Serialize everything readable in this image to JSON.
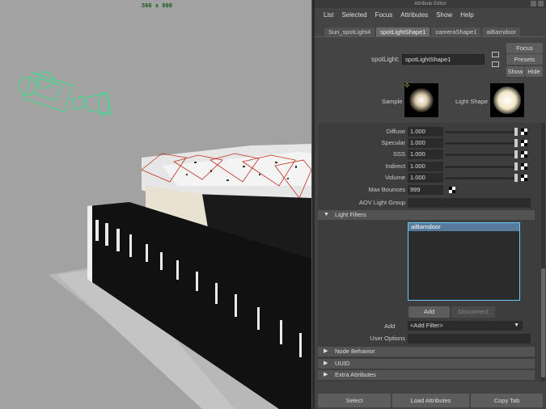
{
  "viewport": {
    "resolution_label": "566 x 800"
  },
  "editor": {
    "window_title": "Attribute Editor",
    "menu": [
      "List",
      "Selected",
      "Focus",
      "Attributes",
      "Show",
      "Help"
    ],
    "tabs": [
      "Sun_spotLight4",
      "spotLightShape1",
      "cameraShape1",
      "aiBarndoor"
    ],
    "node_label": "spotLight:",
    "node_value": "spotLightShape1",
    "buttons": {
      "focus": "Focus",
      "presets": "Presets",
      "show": "Show",
      "hide": "Hide"
    },
    "sample_label": "Sample",
    "light_shape_label": "Light Shape",
    "attributes": [
      {
        "label": "Diffuse",
        "value": "1.000"
      },
      {
        "label": "Specular",
        "value": "1.000"
      },
      {
        "label": "SSS",
        "value": "1.000"
      },
      {
        "label": "Indirect",
        "value": "1.000"
      },
      {
        "label": "Volume",
        "value": "1.000"
      }
    ],
    "max_bounces": {
      "label": "Max Bounces",
      "value": "999"
    },
    "aov_group_label": "AOV Light Group",
    "light_filters": {
      "header": "Light Filters",
      "items": [
        "aiBarndoor"
      ],
      "add_button": "Add",
      "disconnect_button": "Disconnect",
      "add_label": "Add",
      "add_filter_value": "<Add Filter>",
      "user_options_label": "User Options"
    },
    "sections": [
      "Node Behavior",
      "UUID",
      "Extra Attributes"
    ],
    "bottom_buttons": [
      "Select",
      "Load Attributes",
      "Copy Tab"
    ]
  },
  "colors": {
    "accent_selection": "#587a9a",
    "viewport_bg": "#a2a2a2",
    "light_gizmo": "#35e08a",
    "highlight_red": "#c03020"
  }
}
